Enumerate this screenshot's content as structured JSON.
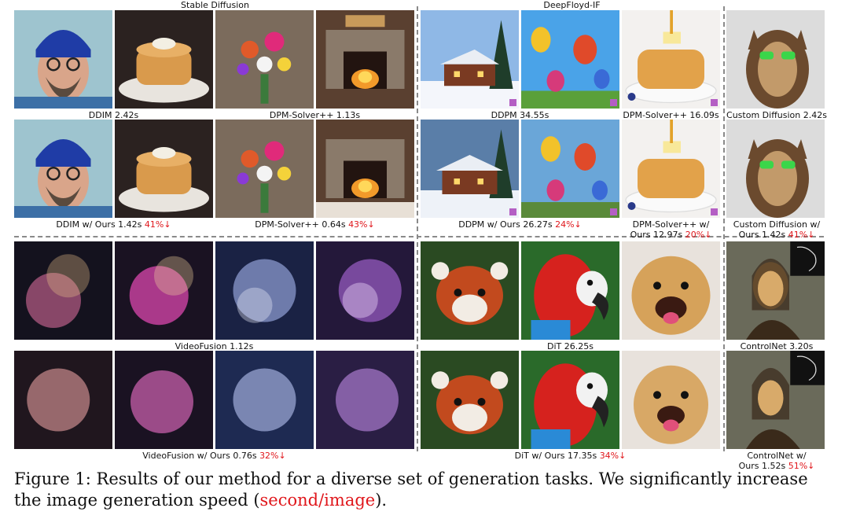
{
  "sections": {
    "stable_diffusion": "Stable Diffusion",
    "deepfloyd": "DeepFloyd-IF",
    "videofusion": "VideoFusion",
    "dit": "DiT",
    "controlnet": "ControlNet"
  },
  "labels": {
    "ddim": "DDIM 2.42s",
    "dpm_sd": "DPM-Solver++ 1.13s",
    "ddim_ours": "DDIM w/ Ours 1.42s",
    "ddim_ours_pct": "41%↓",
    "dpm_sd_ours": "DPM-Solver++ 0.64s",
    "dpm_sd_ours_pct": "43%↓",
    "ddpm": "DDPM 34.55s",
    "dpm_if": "DPM-Solver++ 16.09s",
    "custom": "Custom Diffusion 2.42s",
    "ddpm_ours": "DDPM w/ Ours 26.27s",
    "ddpm_ours_pct": "24%↓",
    "dpm_if_ours_l1": "DPM-Solver++ w/",
    "dpm_if_ours_l2": "Ours 12.97s",
    "dpm_if_ours_pct": "20%↓",
    "custom_ours_l1": "Custom Diffusion w/",
    "custom_ours_l2": "Ours 1.42s",
    "custom_ours_pct": "41%↓",
    "videofusion": "VideoFusion 1.12s",
    "dit": "DiT 26.25s",
    "controlnet": "ControlNet 3.20s",
    "videofusion_ours": "VideoFusion w/ Ours 0.76s",
    "videofusion_ours_pct": "32%↓",
    "dit_ours": "DiT w/ Ours 17.35s",
    "dit_ours_pct": "34%↓",
    "controlnet_ours_l1": "ControlNet w/",
    "controlnet_ours_l2": "Ours 1.52s",
    "controlnet_ours_pct": "51%↓"
  },
  "caption": {
    "prefix": "Figure 1: Results of our method for a diverse set of generation tasks. We significantly increase the image generation speed (",
    "highlight": "second/image",
    "suffix": ")."
  },
  "colors": {
    "highlight": "#e0161b",
    "divider": "#8a8a8a"
  }
}
